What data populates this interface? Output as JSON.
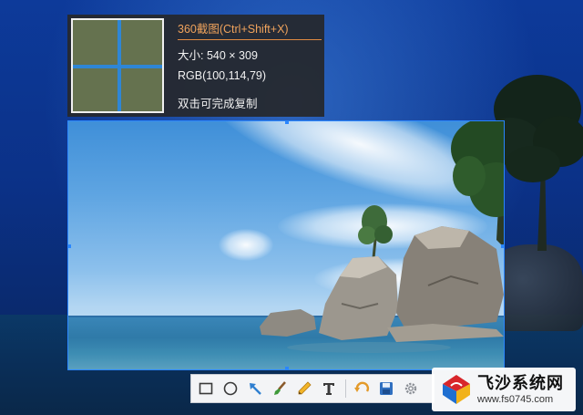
{
  "capture_info": {
    "title": "360截图(Ctrl+Shift+X)",
    "size": "大小: 540 × 309",
    "rgb": "RGB(100,114,79)",
    "hint": "双击可完成复制",
    "magnifier_color": "#64724f"
  },
  "toolbar": {
    "tools": [
      {
        "name": "rectangle-tool",
        "icon": "rectangle-icon"
      },
      {
        "name": "ellipse-tool",
        "icon": "ellipse-icon"
      },
      {
        "name": "arrow-tool",
        "icon": "arrow-icon"
      },
      {
        "name": "brush-tool",
        "icon": "brush-icon"
      },
      {
        "name": "pencil-tool",
        "icon": "pencil-icon"
      },
      {
        "name": "text-tool",
        "icon": "text-icon"
      },
      {
        "name": "undo-tool",
        "icon": "undo-icon"
      },
      {
        "name": "save-tool",
        "icon": "save-icon"
      },
      {
        "name": "settings-tool",
        "icon": "gear-icon"
      }
    ]
  },
  "watermark": {
    "name": "飞沙系统网",
    "url": "www.fs0745.com"
  },
  "colors": {
    "selection_border": "#2a86ff",
    "title_accent": "#f0a35c",
    "panel_bg": "#26282c"
  }
}
